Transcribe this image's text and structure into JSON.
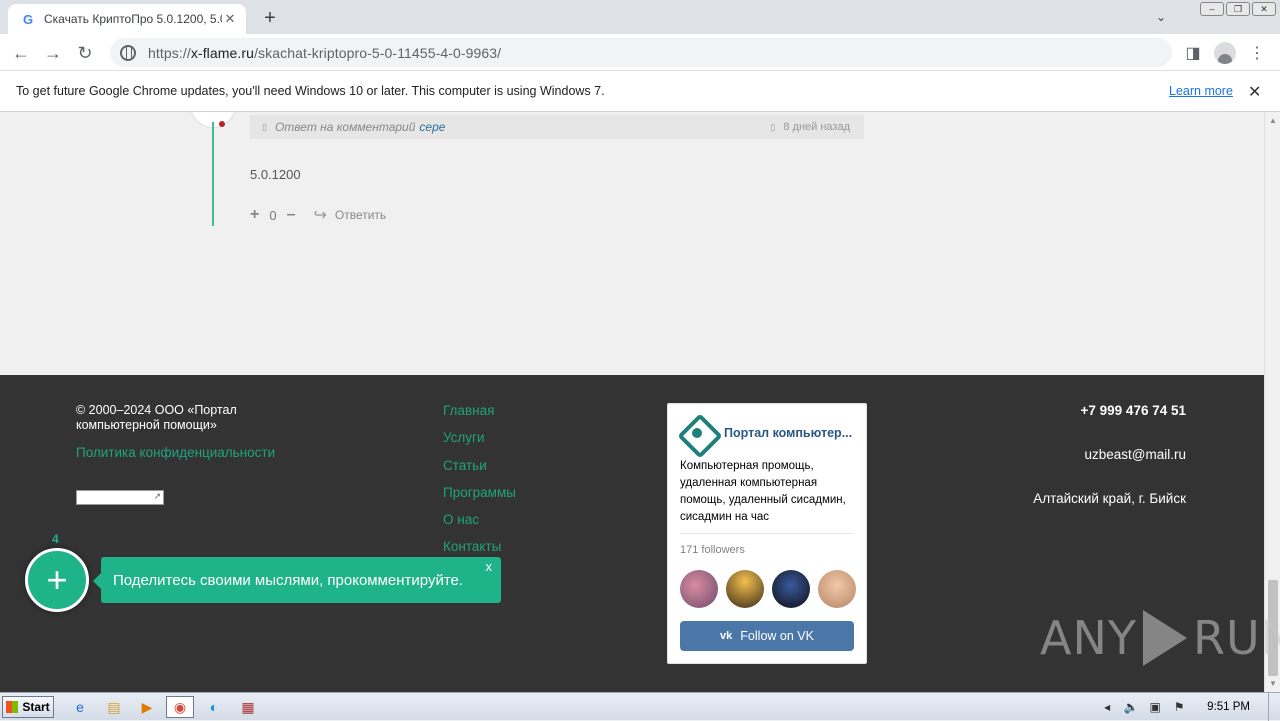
{
  "browser": {
    "tab_title": "Скачать КриптоПро 5.0.1200, 5.0",
    "favicon": "G",
    "url_prefix": "https://",
    "url_host": "x-flame.ru",
    "url_path": "/skachat-kriptopro-5-0-11455-4-0-9963/"
  },
  "infobar": {
    "message": "To get future Google Chrome updates, you'll need Windows 10 or later. This computer is using Windows 7.",
    "learn_more": "Learn more"
  },
  "comment": {
    "reply_to_label": "Ответ на комментарий",
    "reply_to_user": "сере",
    "time": "8 дней назад",
    "text": "5.0.1200",
    "votes": "0",
    "reply_button": "Ответить"
  },
  "footer": {
    "copyright": "© 2000–2024 ООО «Портал компьютерной помощи»",
    "privacy": "Политика конфиденциальности",
    "nav": [
      "Главная",
      "Услуги",
      "Статьи",
      "Программы",
      "О нас",
      "Контакты"
    ],
    "phone": "+7 999 476 74 51",
    "email": "uzbeast@mail.ru",
    "city": "Алтайский край, г. Бийск"
  },
  "vk_widget": {
    "name": "Портал компьютер...",
    "description": "Компьютерная промощь, удаленная компьютерная помощь, удаленный сисадмин, сисадмин на час",
    "followers": "171 followers",
    "follow_button": "Follow on VK",
    "vk_logo_text": "vk"
  },
  "floating": {
    "count": "4",
    "plus": "+",
    "prompt": "Поделитесь своими мыслями, прокомментируйте.",
    "close": "x"
  },
  "watermark": {
    "left": "ANY",
    "right": "RUN"
  },
  "taskbar": {
    "start": "Start",
    "clock": "9:51 PM"
  },
  "colors": {
    "accent_green": "#1fb38a",
    "footer_bg": "#333333",
    "vk_blue": "#4a76a8"
  }
}
